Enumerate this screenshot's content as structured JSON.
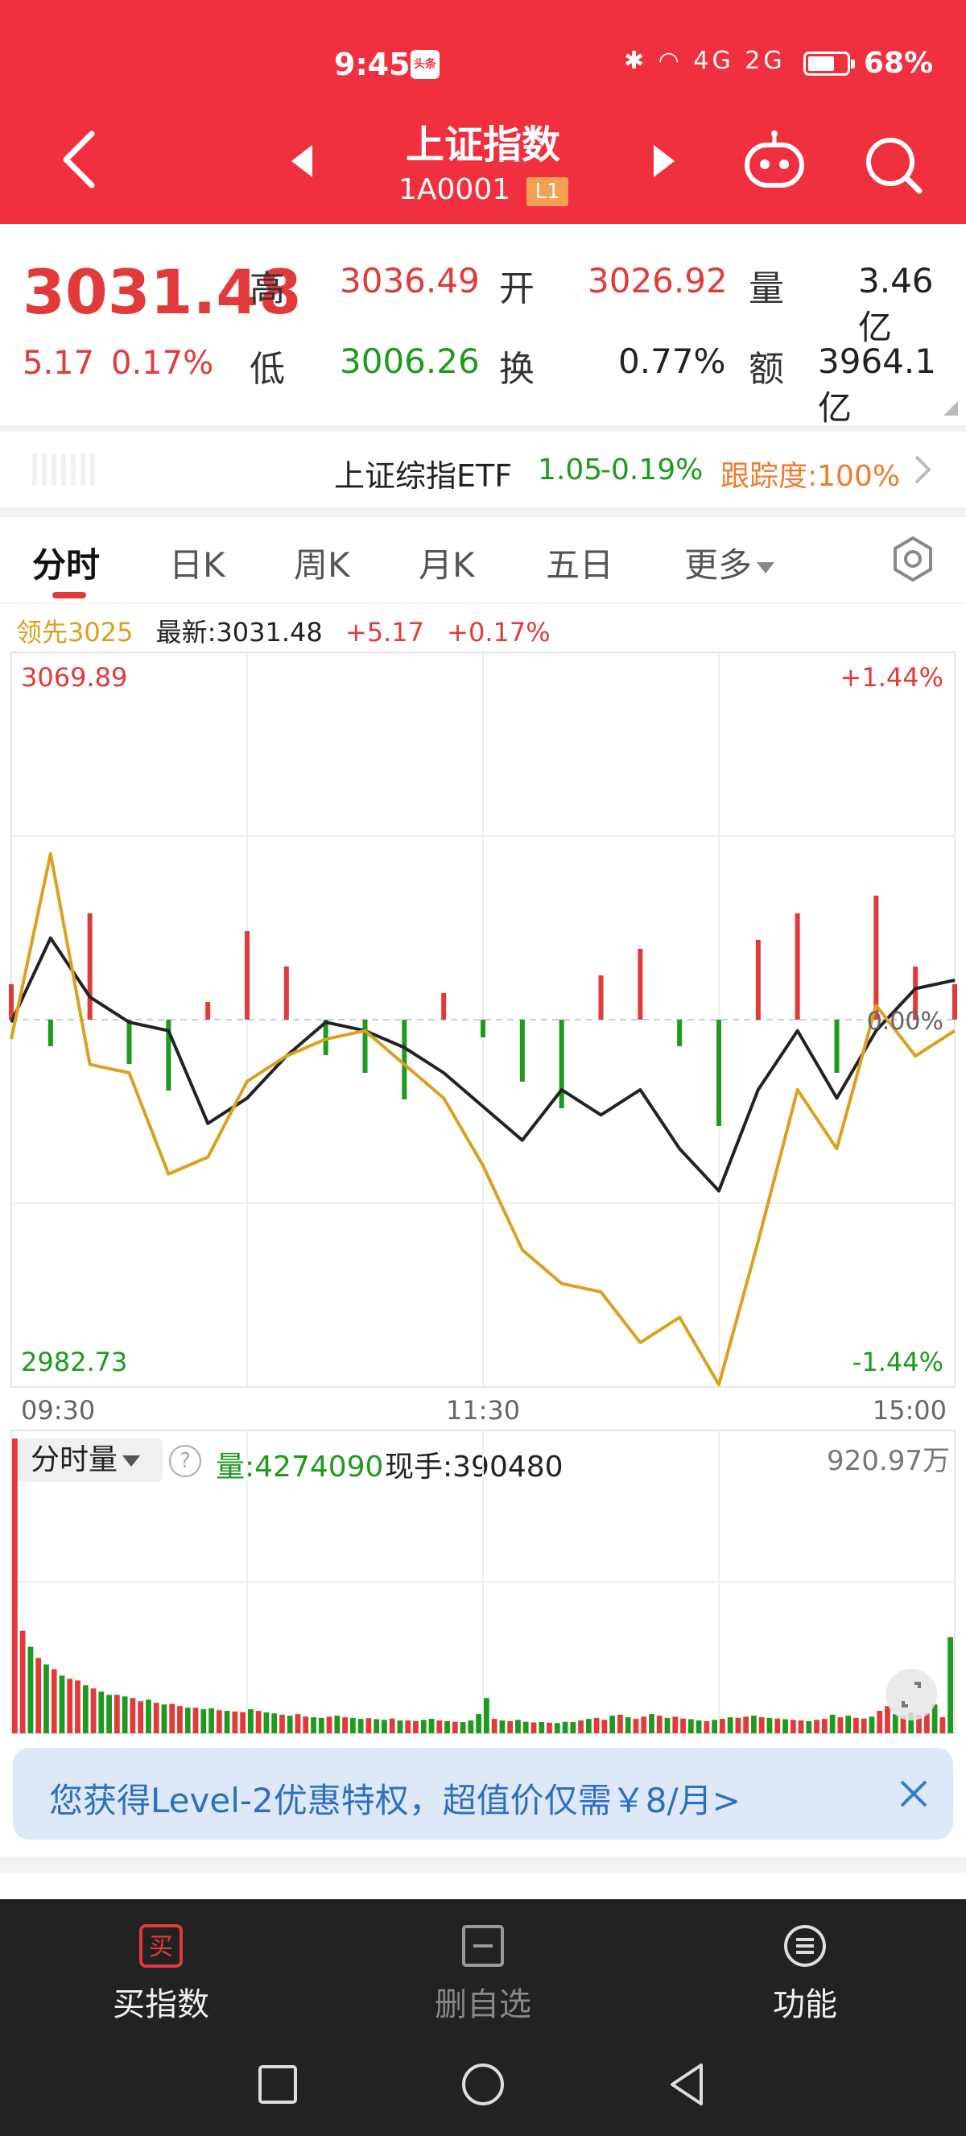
{
  "status_bar": {
    "time": "9:45",
    "app_badge": "头条",
    "network": "4G 2G",
    "battery": "68%"
  },
  "header": {
    "title": "上证指数",
    "code": "1A0001",
    "level_tag": "L1"
  },
  "quote": {
    "last_price": "3031.48",
    "change": "5.17",
    "change_pct": "0.17%",
    "high_label": "高",
    "high": "3036.49",
    "low_label": "低",
    "low": "3006.26",
    "open_label": "开",
    "open": "3026.92",
    "turnover_label": "换",
    "turnover": "0.77%",
    "volume_label": "量",
    "volume": "3.46亿",
    "amount_label": "额",
    "amount": "3964.1亿"
  },
  "etf": {
    "name": "上证综指ETF",
    "price": "1.05",
    "change_pct": "-0.19%",
    "tracking": "跟踪度:100%"
  },
  "tabs": [
    {
      "label": "分时",
      "active": true
    },
    {
      "label": "日K"
    },
    {
      "label": "周K"
    },
    {
      "label": "月K"
    },
    {
      "label": "五日"
    },
    {
      "label": "更多"
    }
  ],
  "legend": {
    "lead": "领先3025",
    "latest": "最新:3031.48",
    "change": "+5.17",
    "change_pct": "+0.17%"
  },
  "colors": {
    "up": "#e23a3a",
    "down": "#1e9a1e",
    "price_line": "#222222",
    "lead_line": "#d9a11e",
    "brand": "#f0303e"
  },
  "chart_data": [
    {
      "type": "line",
      "title": "",
      "x_ticks": [
        "09:30",
        "11:30",
        "15:00"
      ],
      "y_labels": {
        "top": "3069.89",
        "bottom": "2982.73",
        "top_pct": "+1.44%",
        "bottom_pct": "-1.44%",
        "zero_pct": "0.00%"
      },
      "ylim": [
        2982.73,
        3069.89
      ],
      "reference": 3026.31,
      "x": [
        0,
        10,
        20,
        30,
        40,
        50,
        60,
        70,
        80,
        90,
        100,
        110,
        120,
        130,
        140,
        150,
        160,
        170,
        180,
        190,
        200,
        210,
        220,
        230,
        240
      ],
      "series": [
        {
          "values": [
            3026,
            3036,
            3029,
            3026,
            3025,
            3014,
            3017,
            3022,
            3026,
            3025,
            3023,
            3020,
            3016,
            3012,
            3018,
            3015,
            3018,
            3011,
            3006,
            3018,
            3025,
            3017,
            3025,
            3030,
            3031
          ]
        },
        {
          "values": [
            3024,
            3046,
            3021,
            3020,
            3008,
            3010,
            3019,
            3022,
            3024,
            3025,
            3021,
            3017,
            3009,
            2999,
            2995,
            2994,
            2988,
            2991,
            2983,
            3000,
            3018,
            3011,
            3028,
            3022,
            3025
          ]
        }
      ],
      "bars": [
        4,
        -3,
        12,
        -5,
        -8,
        2,
        10,
        6,
        -4,
        -6,
        -9,
        3,
        -2,
        -7,
        -10,
        5,
        8,
        -3,
        -12,
        9,
        12,
        -6,
        14,
        6,
        4
      ]
    },
    {
      "type": "bar",
      "title": "",
      "header": {
        "selector": "分时量",
        "help": "?",
        "volume": "量:4274090",
        "current": "现手:390480",
        "max": "920.97万"
      },
      "values": [
        920,
        320,
        270,
        235,
        215,
        200,
        180,
        170,
        165,
        150,
        140,
        130,
        120,
        120,
        115,
        110,
        100,
        105,
        95,
        90,
        92,
        85,
        80,
        80,
        75,
        78,
        72,
        70,
        68,
        66,
        75,
        70,
        65,
        62,
        58,
        55,
        60,
        52,
        50,
        48,
        52,
        55,
        50,
        48,
        45,
        47,
        44,
        42,
        46,
        40,
        40,
        38,
        42,
        45,
        40,
        38,
        36,
        35,
        40,
        60,
        110,
        45,
        40,
        38,
        42,
        36,
        34,
        35,
        33,
        32,
        36,
        35,
        40,
        45,
        48,
        42,
        55,
        58,
        50,
        45,
        52,
        60,
        55,
        48,
        52,
        46,
        44,
        40,
        38,
        42,
        45,
        50,
        48,
        52,
        55,
        50,
        48,
        46,
        44,
        42,
        40,
        38,
        42,
        45,
        58,
        50,
        55,
        48,
        46,
        52,
        70,
        85,
        60,
        55,
        65,
        58,
        62,
        90,
        50,
        300
      ],
      "ups": [
        1,
        1,
        0,
        1,
        0,
        1,
        0,
        1,
        1,
        0,
        1,
        0,
        0,
        1,
        0,
        1,
        1,
        0,
        1,
        0,
        1,
        1,
        0,
        1,
        0,
        0,
        1,
        0,
        1,
        1,
        0,
        1,
        0,
        0,
        1,
        0,
        1,
        1,
        0,
        0,
        1,
        0,
        1,
        0,
        0,
        1,
        0,
        0,
        1,
        0,
        1,
        1,
        0,
        0,
        1,
        0,
        1,
        0,
        0,
        0,
        0,
        1,
        0,
        1,
        0,
        0,
        1,
        0,
        1,
        0,
        0,
        0,
        1,
        0,
        1,
        1,
        0,
        1,
        0,
        1,
        1,
        0,
        1,
        0,
        1,
        1,
        0,
        0,
        1,
        0,
        1,
        0,
        1,
        1,
        0,
        1,
        0,
        1,
        0,
        1,
        1,
        0,
        1,
        1,
        0,
        1,
        0,
        1,
        1,
        0,
        1,
        1,
        0,
        1,
        0,
        1,
        1,
        0,
        1,
        0
      ]
    }
  ],
  "promo": {
    "text": "您获得Level-2优惠特权，超值价仅需￥8/月>"
  },
  "toolbar": {
    "buy_icon": "买",
    "buy_label": "买指数",
    "remove_label": "删自选",
    "func_label": "功能"
  }
}
